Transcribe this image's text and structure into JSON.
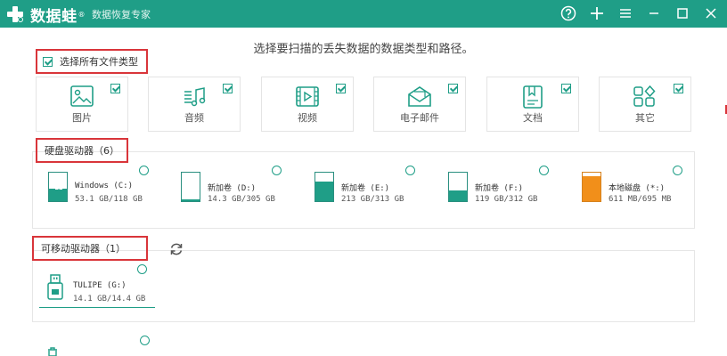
{
  "app": {
    "logo_text": "数据蛙",
    "logo_sup": "®",
    "subtitle": "数据恢复专家",
    "brand_color": "#1f9e87"
  },
  "titlebar_buttons": [
    {
      "name": "help-icon"
    },
    {
      "name": "plus-icon"
    },
    {
      "name": "menu-icon"
    },
    {
      "name": "minimize-icon"
    },
    {
      "name": "maximize-icon"
    },
    {
      "name": "close-icon"
    }
  ],
  "instruction": "选择要扫描的丢失数据的数据类型和路径。",
  "select_all": {
    "label": "选择所有文件类型",
    "checked": true
  },
  "file_types": [
    {
      "label": "图片",
      "icon": "image-icon",
      "checked": true
    },
    {
      "label": "音频",
      "icon": "audio-icon",
      "checked": true
    },
    {
      "label": "视频",
      "icon": "video-icon",
      "checked": true
    },
    {
      "label": "电子邮件",
      "icon": "email-icon",
      "checked": true
    },
    {
      "label": "文档",
      "icon": "document-icon",
      "checked": true
    },
    {
      "label": "其它",
      "icon": "other-icon",
      "checked": true
    }
  ],
  "hdd_section": {
    "title": "硬盘驱动器（6）",
    "drives": [
      {
        "name": "Windows (C:)",
        "size": "53.1 GB/118 GB",
        "fill": 0.45,
        "color": "teal",
        "selected": false
      },
      {
        "name": "新加卷 (D:)",
        "size": "14.3 GB/305 GB",
        "fill": 0.05,
        "color": "teal",
        "selected": false
      },
      {
        "name": "新加卷 (E:)",
        "size": "213 GB/313 GB",
        "fill": 0.68,
        "color": "teal",
        "selected": false
      },
      {
        "name": "新加卷 (F:)",
        "size": "119 GB/312 GB",
        "fill": 0.38,
        "color": "teal",
        "selected": false
      },
      {
        "name": "本地磁盘 (*:)",
        "size": "611 MB/695 MB",
        "fill": 0.88,
        "color": "orange",
        "selected": false
      }
    ]
  },
  "removable_section": {
    "title": "可移动驱动器（1）",
    "drives": [
      {
        "name": "TULIPE (G:)",
        "size": "14.1 GB/14.4 GB",
        "selected": true
      }
    ]
  }
}
